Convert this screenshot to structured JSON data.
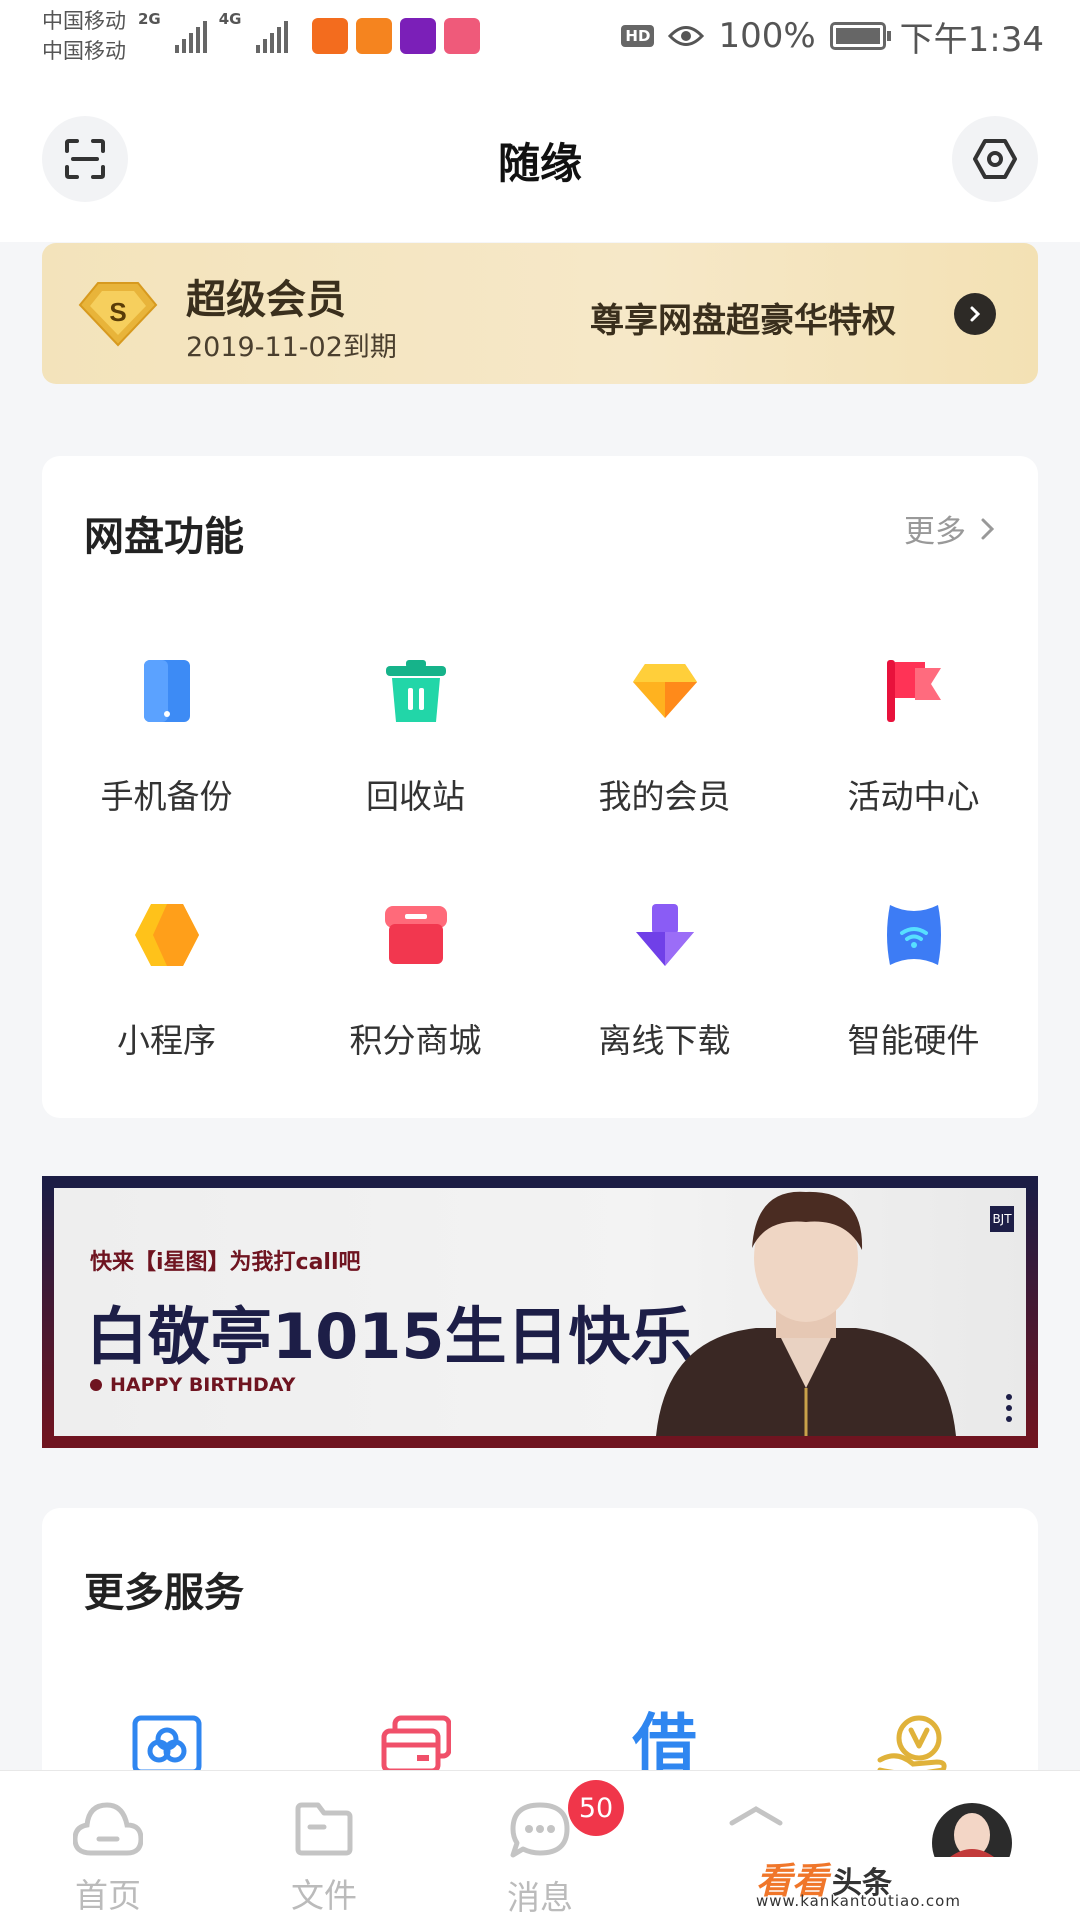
{
  "status_bar": {
    "carrier_1": "中国移动",
    "carrier_2": "中国移动",
    "network_1": "2G",
    "network_2": "4G",
    "hd": "HD",
    "battery": "100%",
    "time": "下午1:34"
  },
  "header": {
    "title": "随缘",
    "scan_icon": "scan-icon",
    "settings_icon": "settings-icon"
  },
  "vip": {
    "title": "超级会员",
    "expiry": "2019-11-02到期",
    "promo": "尊享网盘超豪华特权",
    "badge_letter": "S"
  },
  "features": {
    "title": "网盘功能",
    "more": "更多",
    "items": [
      {
        "label": "手机备份",
        "icon": "phone-backup-icon",
        "color": "#3d8bf5"
      },
      {
        "label": "回收站",
        "icon": "trash-icon",
        "color": "#19c79b"
      },
      {
        "label": "我的会员",
        "icon": "diamond-icon",
        "color": "#ffa21a"
      },
      {
        "label": "活动中心",
        "icon": "flag-icon",
        "color": "#f5284a"
      },
      {
        "label": "小程序",
        "icon": "mini-program-icon",
        "color": "#ffb800"
      },
      {
        "label": "积分商城",
        "icon": "shop-icon",
        "color": "#f5465a"
      },
      {
        "label": "离线下载",
        "icon": "download-icon",
        "color": "#7b4ff0"
      },
      {
        "label": "智能硬件",
        "icon": "smart-hardware-icon",
        "color": "#3d7cf5"
      }
    ]
  },
  "banner": {
    "subtitle": "快来【i星图】为我打call吧",
    "headline": "白敬亭1015生日快乐",
    "english": "HAPPY BIRTHDAY",
    "logo": "BJT"
  },
  "services": {
    "title": "更多服务",
    "items": [
      {
        "icon": "cloud-photo-icon",
        "color": "#2f86f0"
      },
      {
        "icon": "card-icon",
        "color": "#f0506a"
      },
      {
        "icon": "loan-icon",
        "color": "#2f86f0",
        "glyph": "借"
      },
      {
        "icon": "vip-hand-icon",
        "color": "#e0b23a"
      }
    ]
  },
  "bottom_nav": {
    "items": [
      {
        "label": "首页",
        "icon": "home-cloud-icon"
      },
      {
        "label": "文件",
        "icon": "folder-icon"
      },
      {
        "label": "消息",
        "icon": "chat-icon"
      },
      {
        "label": "",
        "icon": "discover-icon"
      },
      {
        "label": "",
        "icon": "avatar"
      }
    ],
    "message_badge": "50"
  },
  "watermark": {
    "brand_a": "看看",
    "brand_b": "头条",
    "url": "www.kankantoutiao.com"
  }
}
